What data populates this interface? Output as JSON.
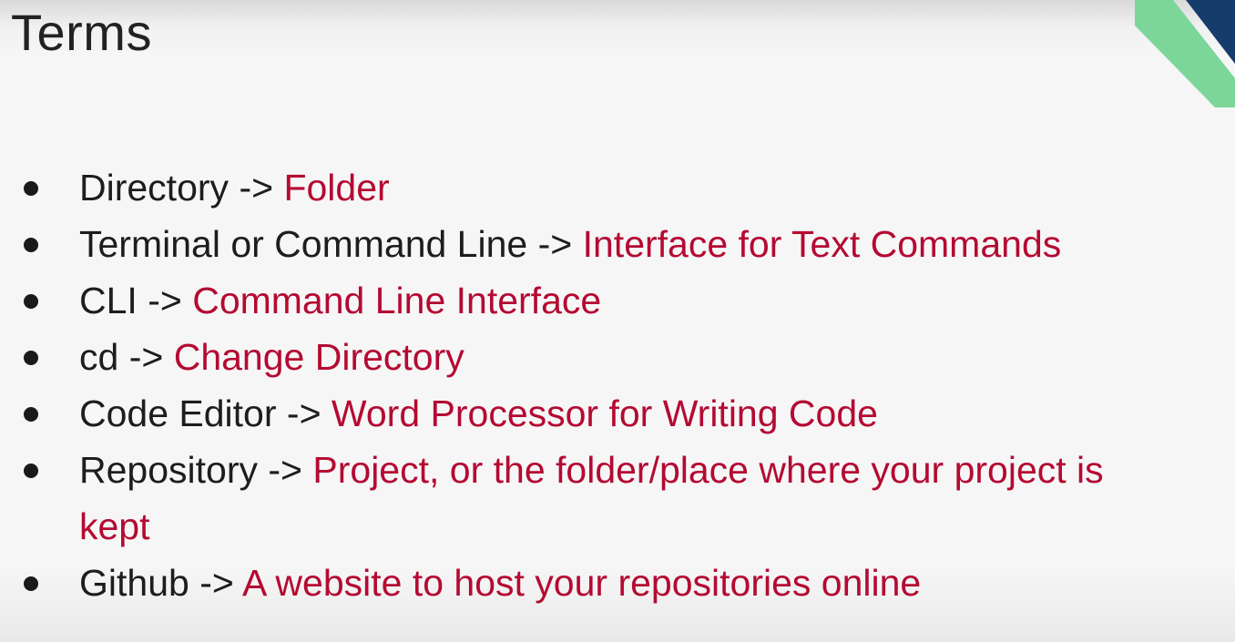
{
  "slide": {
    "title": "Terms",
    "accent_colors": {
      "definition": "#b40a32",
      "corner_green": "#7cd69a",
      "corner_navy": "#153c6b"
    },
    "items": [
      {
        "term": "Directory",
        "arrow": "->",
        "definition": "Folder"
      },
      {
        "term": "Terminal or Command Line",
        "arrow": "->",
        "definition": "Interface for Text Commands"
      },
      {
        "term": "CLI",
        "arrow": "->",
        "definition": "Command Line Interface"
      },
      {
        "term": "cd",
        "arrow": "->",
        "definition": "Change Directory"
      },
      {
        "term": "Code Editor",
        "arrow": "->",
        "definition": "Word Processor for Writing Code"
      },
      {
        "term": "Repository",
        "arrow": "->",
        "definition": "Project, or the folder/place where your project is",
        "definition_cont": "kept"
      },
      {
        "term": "Github",
        "arrow": "->",
        "definition": "A website to host your repositories online"
      }
    ]
  }
}
